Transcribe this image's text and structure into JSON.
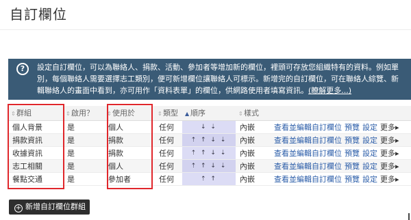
{
  "page": {
    "title": "自訂欄位"
  },
  "info": {
    "icon": "question-circle-icon",
    "line1": "設定自訂欄位，可以為聯絡人、捐款、活動、參加者等增加新的欄位，裡頭可存放您組織特有的資料。例如單",
    "line2": "別，每個聯絡人需要選擇志工類別，便可新增欄位讓聯絡人可標示。新增完的自訂欄位，可在聯絡人綜覽、新",
    "line3_pre": "輯聯絡人的畫面中看到，亦可用作「資料表單」的欄位，供網路使用者填寫資訊。",
    "learn_more": "(瞭解更多...)"
  },
  "table": {
    "headers": {
      "group": "群組",
      "enabled": "啟用？",
      "used_for": "使用於",
      "type": "類型",
      "order": "順序",
      "style": "樣式"
    },
    "rows": [
      {
        "group": "個人背景",
        "enabled": "是",
        "used_for": "個人",
        "type": "任何",
        "order": "↓ ⇣",
        "style": "內嵌",
        "view_edit": "查看並編輯自訂欄位",
        "preview": "預覽",
        "settings": "設定",
        "more": "更多"
      },
      {
        "group": "捐款資訊",
        "enabled": "是",
        "used_for": "捐款",
        "type": "任何",
        "order": "⇡ ↑ ↓ ⇣",
        "style": "內嵌",
        "view_edit": "查看並編輯自訂欄位",
        "preview": "預覽",
        "settings": "設定",
        "more": "更多"
      },
      {
        "group": "收據資訊",
        "enabled": "是",
        "used_for": "捐款",
        "type": "任何",
        "order": "⇡ ↑ ↓ ⇣",
        "style": "內嵌",
        "view_edit": "查看並編輯自訂欄位",
        "preview": "預覽",
        "settings": "設定",
        "more": "更多"
      },
      {
        "group": "志工相關",
        "enabled": "是",
        "used_for": "個人",
        "type": "任何",
        "order": "⇡ ↑ ↓ ⇣",
        "style": "內嵌",
        "view_edit": "查看並編輯自訂欄位",
        "preview": "預覽",
        "settings": "設定",
        "more": "更多"
      },
      {
        "group": "餐點交通",
        "enabled": "是",
        "used_for": "參加者",
        "type": "任何",
        "order": "⇡ ↑",
        "style": "內嵌",
        "view_edit": "查看並編輯自訂欄位",
        "preview": "預覽",
        "settings": "設定",
        "more": "更多"
      }
    ]
  },
  "add_button": {
    "label": "新增自訂欄位群組",
    "icon": "plus-circle-icon"
  },
  "colors": {
    "banner_bg": "#3a5b76",
    "highlight_border": "#e0262b",
    "link": "#2a5ca8",
    "order_bg": "#dcdcf5"
  }
}
